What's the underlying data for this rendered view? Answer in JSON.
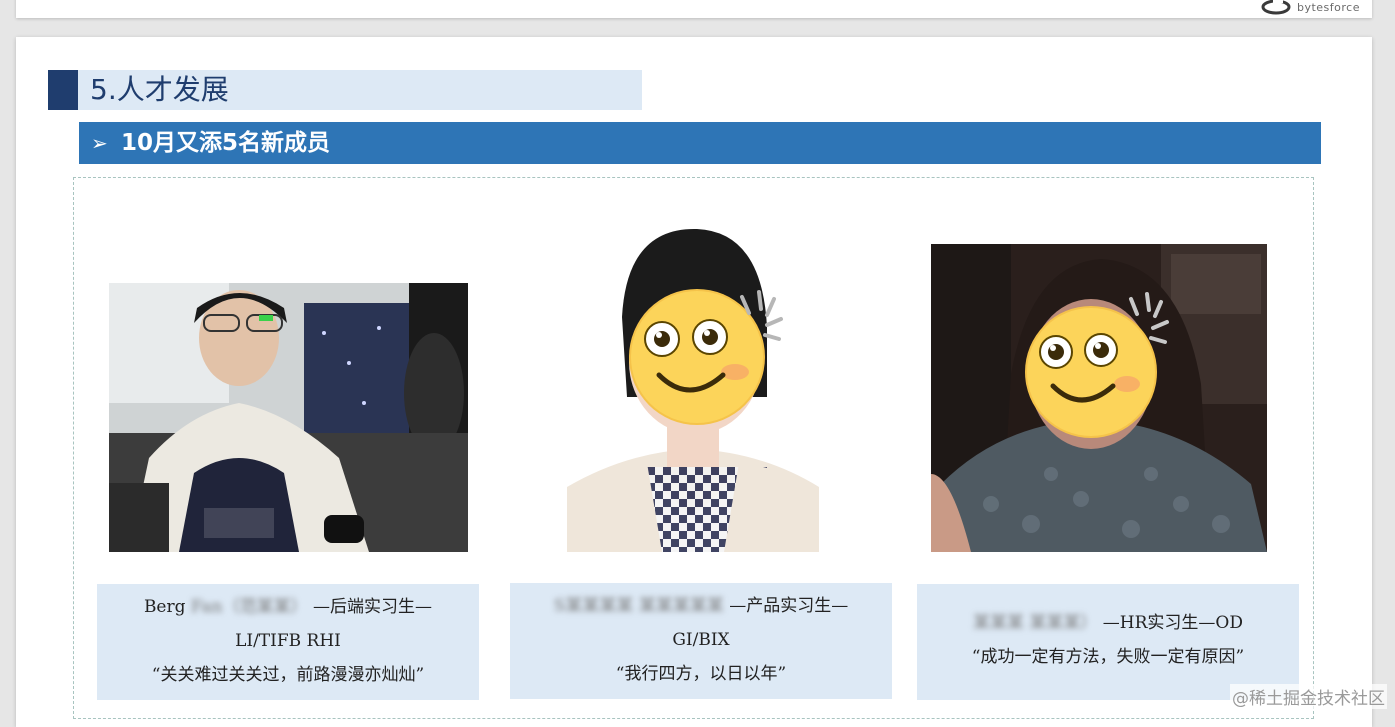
{
  "logo": {
    "text": "bytesforce"
  },
  "section": {
    "title": "5.人才发展"
  },
  "banner": {
    "arrow": "➢",
    "title": "10月又添5名新成员"
  },
  "members": [
    {
      "line1_name": "Berg",
      "line1_hidden": "Fan（范某某）",
      "line1_role": "—后端实习生—",
      "line2": "LI/TIFB RHI",
      "quote": "“关关难过关关过，前路漫漫亦灿灿”"
    },
    {
      "line1_hidden": "S某某某某  某某某某某",
      "line1_role": "—产品实习生—",
      "line2": "GI/BIX",
      "quote": "“我行四方，以日以年”"
    },
    {
      "line1_hidden": "某某某  某某某）",
      "line1_role": "—HR实习生—OD",
      "quote": "“成功一定有方法，失败一定有原因”"
    }
  ],
  "watermark": "@稀土掘金技术社区",
  "colors": {
    "navy": "#1f3d6e",
    "banner_blue": "#2e75b6",
    "light_blue": "#dde9f5",
    "dashed_border": "#a8c4c0"
  }
}
